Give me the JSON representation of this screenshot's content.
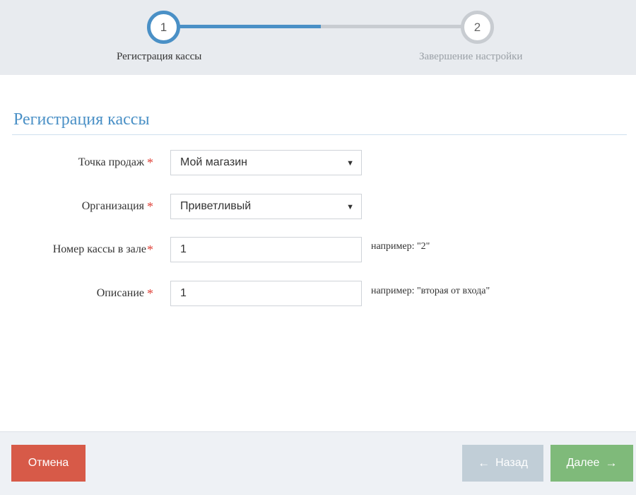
{
  "stepper": {
    "steps": [
      {
        "number": "1",
        "label": "Регистрация кассы",
        "state": "active"
      },
      {
        "number": "2",
        "label": "Завершение настройки",
        "state": "pending"
      }
    ]
  },
  "section": {
    "title": "Регистрация кассы"
  },
  "form": {
    "fields": [
      {
        "label": "Точка продаж",
        "required": "*",
        "type": "select",
        "value": "Мой магазин",
        "hint": ""
      },
      {
        "label": "Организация",
        "required": "*",
        "type": "select",
        "value": "Приветливый",
        "hint": ""
      },
      {
        "label": "Номер кассы в зале",
        "required": "*",
        "type": "text",
        "value": "1",
        "hint": "например: \"2\""
      },
      {
        "label": "Описание",
        "required": "*",
        "type": "text",
        "value": "1",
        "hint": "например: \"вторая от входа\""
      }
    ],
    "dropdown_arrow": "▼"
  },
  "footer": {
    "cancel_label": "Отмена",
    "back_label": "Назад",
    "next_label": "Далее",
    "back_icon": "arrow-left-icon",
    "next_icon": "arrow-right-icon",
    "back_glyph": "←",
    "next_glyph": "→"
  },
  "colors": {
    "accent": "#4a90c6",
    "required": "#e0443b",
    "cancel": "#d75a48",
    "back_disabled": "#c1ced7",
    "next": "#7fba7a"
  }
}
